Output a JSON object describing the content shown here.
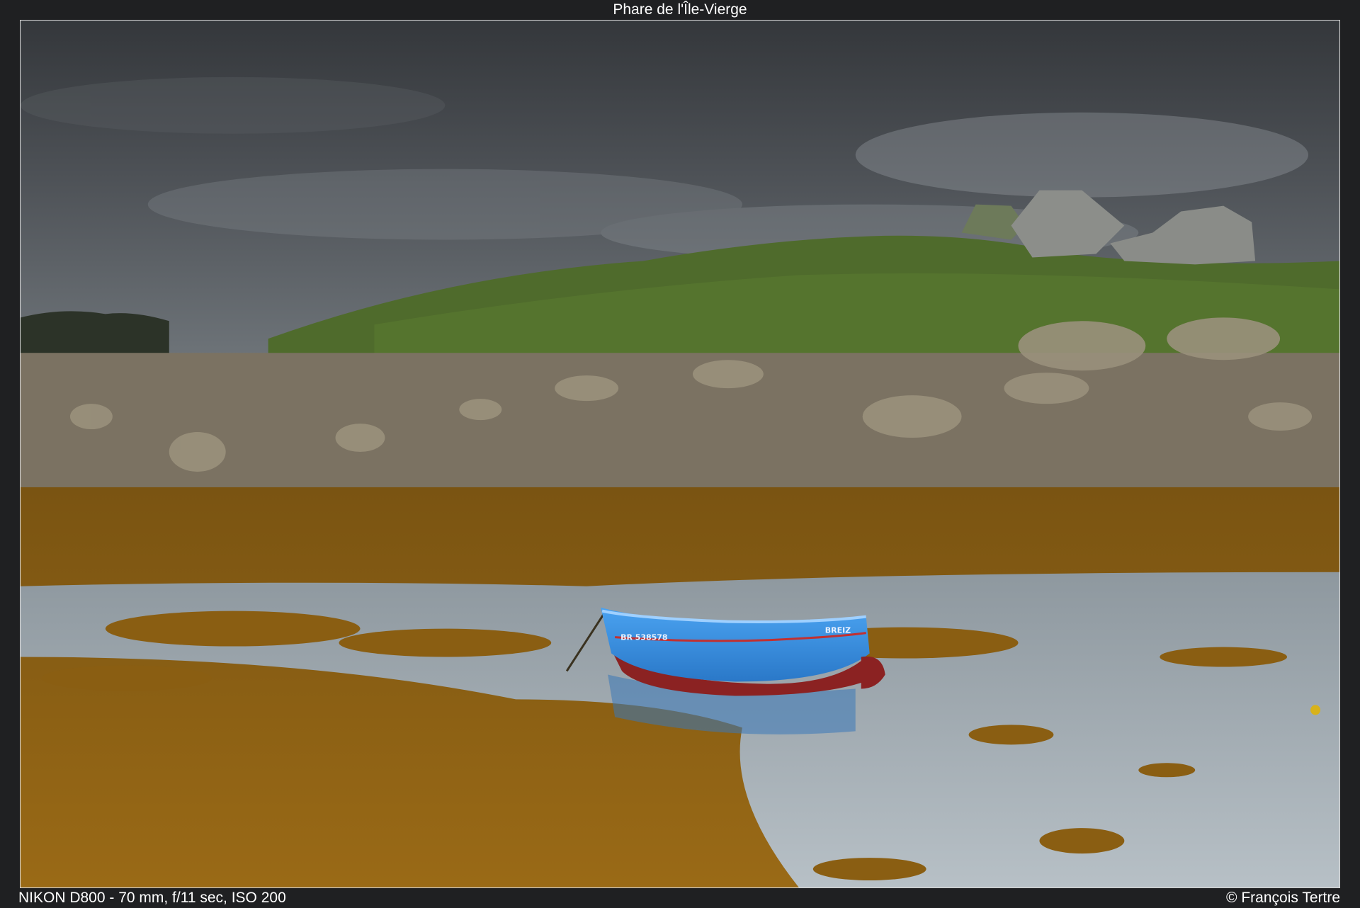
{
  "header": {
    "title": "Phare de l'Île-Vierge"
  },
  "footer": {
    "exif": "NIKON D800 - 70 mm, f/11 sec, ISO 200",
    "credit": "© François Tertre"
  },
  "photo": {
    "boat": {
      "registration": "BR 538578",
      "name": "BREIZ"
    },
    "colors": {
      "sky": "#4a4d52",
      "grass": "#4f6b2c",
      "rocks": "#8a7f6a",
      "seaweed": "#8a5e12",
      "water": "#9aa5ae",
      "boat_hull": "#3a8fe0",
      "boat_bottom": "#8b2222"
    }
  }
}
